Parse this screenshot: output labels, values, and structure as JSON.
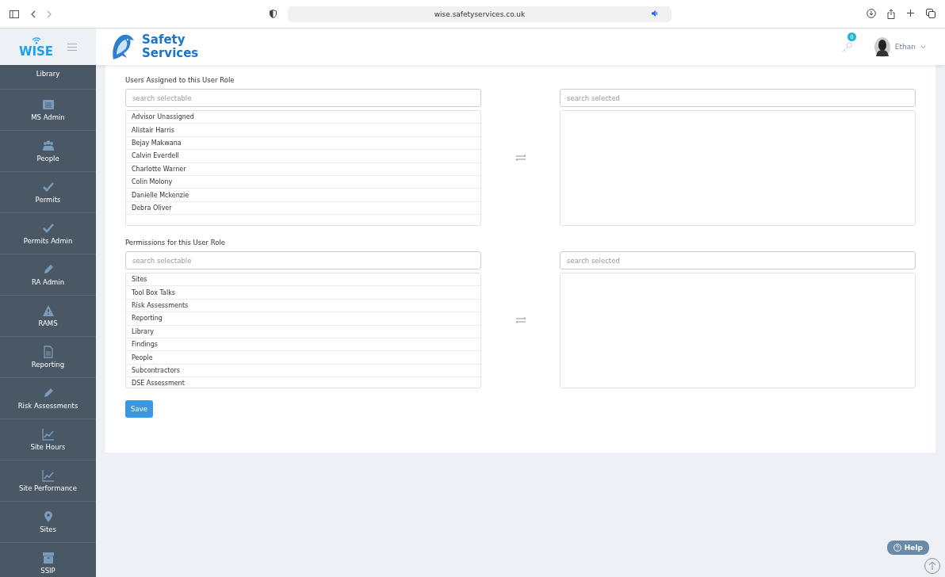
{
  "browser": {
    "url": "wise.safetyservices.co.uk"
  },
  "header": {
    "app_logo": "WISE",
    "brand": "Safety Services",
    "notifications": "0",
    "user": "Ethan"
  },
  "sidebar": {
    "items": [
      {
        "label": "Library",
        "kind": "none"
      },
      {
        "label": "MS Admin",
        "kind": "list"
      },
      {
        "label": "People",
        "kind": "people"
      },
      {
        "label": "Permits",
        "kind": "check"
      },
      {
        "label": "Permits Admin",
        "kind": "check"
      },
      {
        "label": "RA Admin",
        "kind": "pencil"
      },
      {
        "label": "RAMS",
        "kind": "warning"
      },
      {
        "label": "Reporting",
        "kind": "doc"
      },
      {
        "label": "Risk Assessments",
        "kind": "pencil"
      },
      {
        "label": "Site Hours",
        "kind": "chart"
      },
      {
        "label": "Site Performance",
        "kind": "chart"
      },
      {
        "label": "Sites",
        "kind": "pin"
      },
      {
        "label": "SSIP",
        "kind": "archive"
      }
    ]
  },
  "sections": [
    {
      "title": "Users Assigned to this User Role",
      "search_left": {
        "placeholder": "search selectable"
      },
      "search_right": {
        "placeholder": "search selected"
      },
      "items": [
        "Advisor Unassigned",
        "Alistair Harris",
        "Bejay Makwana",
        "Calvin Everdell",
        "Charlotte Warner",
        "Colin Molony",
        "Danielle Mckenzie",
        "Debra Oliver"
      ]
    },
    {
      "title": "Permissions for this User Role",
      "search_left": {
        "placeholder": "search selectable"
      },
      "search_right": {
        "placeholder": "search selected"
      },
      "items": [
        "Sites",
        "Tool Box Talks",
        "Risk Assessments",
        "Reporting",
        "Library",
        "Findings",
        "People",
        "Subcontractors",
        "DSE Assessment"
      ]
    }
  ],
  "save_button": "Save",
  "help_button": "Help"
}
